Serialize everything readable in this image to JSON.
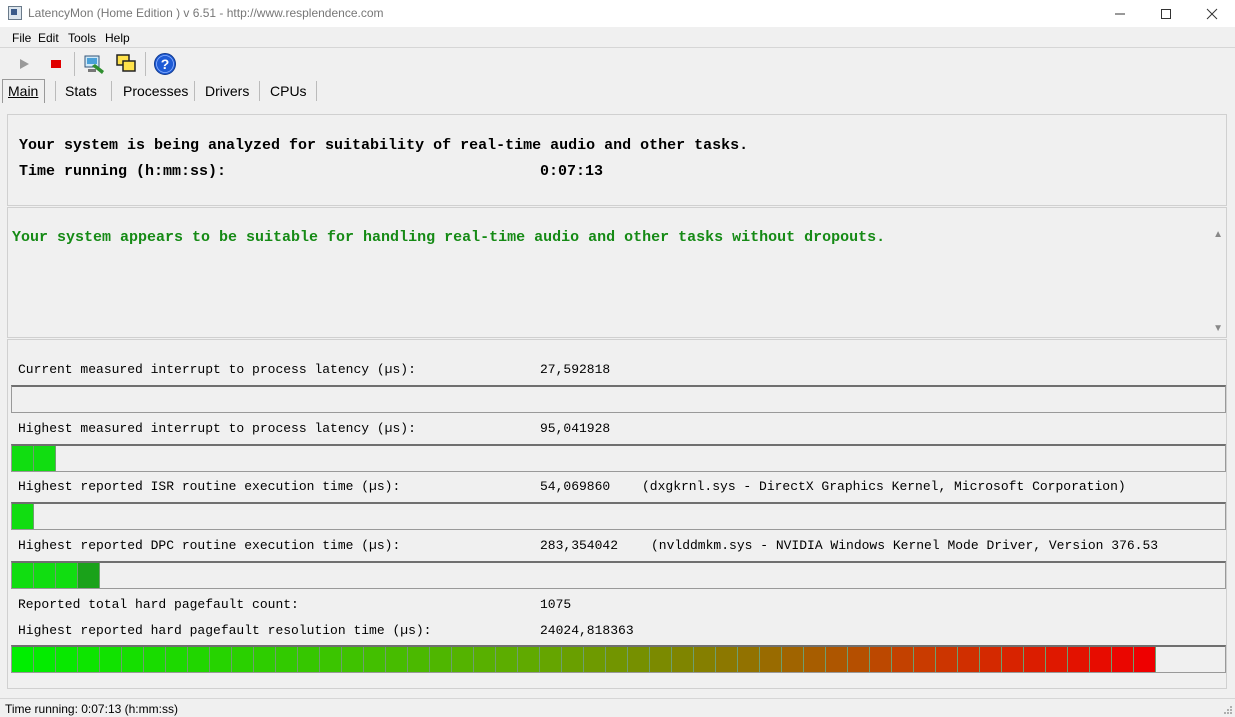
{
  "window": {
    "title": "LatencyMon  (Home Edition )  v 6.51 - http://www.resplendence.com",
    "minimize": "—",
    "maximize": "☐",
    "close": "✕"
  },
  "menu": [
    "File",
    "Edit",
    "Tools",
    "Help"
  ],
  "toolbar": {
    "play_icon": "play-icon",
    "stop_icon": "stop-icon",
    "settings_icon": "settings-icon",
    "windows_icon": "windows-icon",
    "help_icon": "help-icon"
  },
  "tabs": [
    "Main",
    "Stats",
    "Processes",
    "Drivers",
    "CPUs"
  ],
  "analysis": {
    "line1": "Your system is being analyzed for suitability of real-time audio and other tasks.",
    "time_label": "Time running (h:mm:ss):",
    "time_value": "0:07:13"
  },
  "verdict": {
    "text": "Your system appears to be suitable for handling real-time audio and other tasks without dropouts.",
    "color": "#158a15"
  },
  "metrics": [
    {
      "label": "Current measured interrupt to process latency (µs):",
      "value": "27,592818",
      "detail": "",
      "bar_segments": 0
    },
    {
      "label": "Highest measured interrupt to process latency (µs):",
      "value": "95,041928",
      "detail": "",
      "bar_segments": 2
    },
    {
      "label": "Highest reported ISR routine execution time (µs):",
      "value": "54,069860",
      "detail": "(dxgkrnl.sys - DirectX Graphics Kernel, Microsoft Corporation)",
      "bar_segments": 1
    },
    {
      "label": "Highest reported DPC routine execution time (µs):",
      "value": "283,354042",
      "detail": "(nvlddmkm.sys - NVIDIA Windows Kernel Mode Driver, Version 376.53",
      "bar_segments": 4
    }
  ],
  "pagefault": {
    "count_label": "Reported total hard pagefault count:",
    "count_value": "1075",
    "time_label": "Highest reported hard pagefault resolution time (µs):",
    "time_value": "24024,818363",
    "bar_segments": 52
  },
  "status": {
    "text": "Time running: 0:07:13  (h:mm:ss)"
  }
}
